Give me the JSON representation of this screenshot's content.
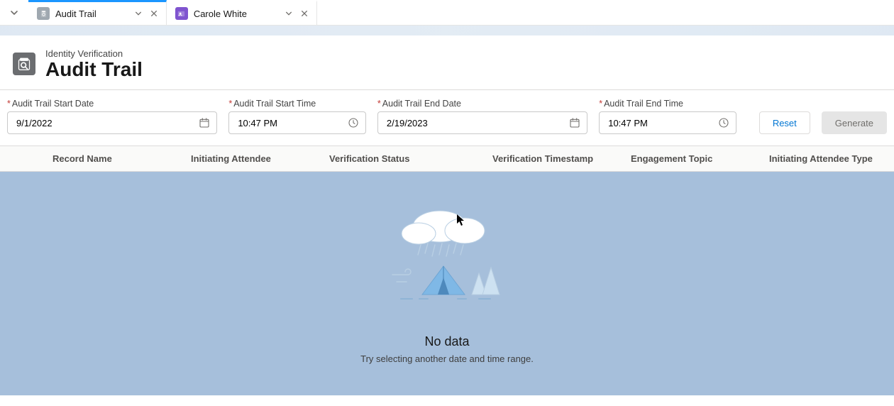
{
  "tabs": [
    {
      "label": "Audit Trail",
      "active": true
    },
    {
      "label": "Carole White",
      "active": false
    }
  ],
  "header": {
    "kicker": "Identity Verification",
    "title": "Audit Trail"
  },
  "filters": {
    "start_date": {
      "label": "Audit Trail Start Date",
      "value": "9/1/2022"
    },
    "start_time": {
      "label": "Audit Trail Start Time",
      "value": "10:47 PM"
    },
    "end_date": {
      "label": "Audit Trail End Date",
      "value": "2/19/2023"
    },
    "end_time": {
      "label": "Audit Trail End Time",
      "value": "10:47 PM"
    }
  },
  "buttons": {
    "reset": "Reset",
    "generate": "Generate"
  },
  "columns": {
    "record_name": "Record Name",
    "initiating_attendee": "Initiating Attendee",
    "verification_status": "Verification Status",
    "verification_timestamp": "Verification Timestamp",
    "engagement_topic": "Engagement Topic",
    "initiating_attendee_type": "Initiating Attendee Type"
  },
  "empty": {
    "title": "No data",
    "subtitle": "Try selecting another date and time range."
  }
}
